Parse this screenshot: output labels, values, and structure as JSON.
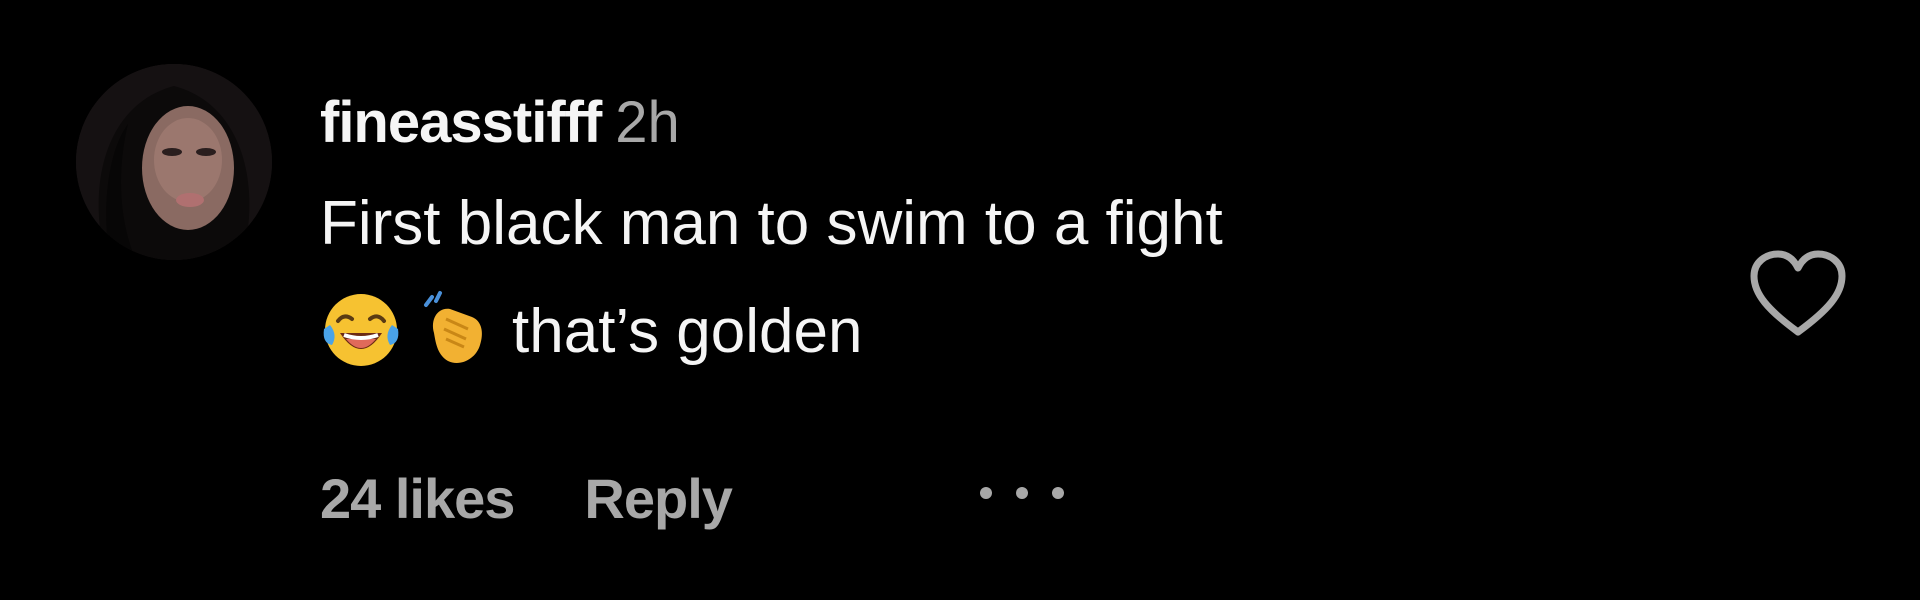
{
  "comment": {
    "username": "fineasstifff",
    "timestamp": "2h",
    "text_line_1": "First black man to swim to a fight",
    "text_line_2": "that’s golden",
    "emojis": [
      "face-with-tears-of-joy",
      "clapping-hands"
    ],
    "likes_label": "24 likes",
    "reply_label": "Reply",
    "more_icon": "ellipsis-icon",
    "like_icon": "heart-outline-icon"
  },
  "colors": {
    "background": "#000000",
    "primary_text": "#f5f5f5",
    "secondary_text": "#a8a8a8"
  }
}
